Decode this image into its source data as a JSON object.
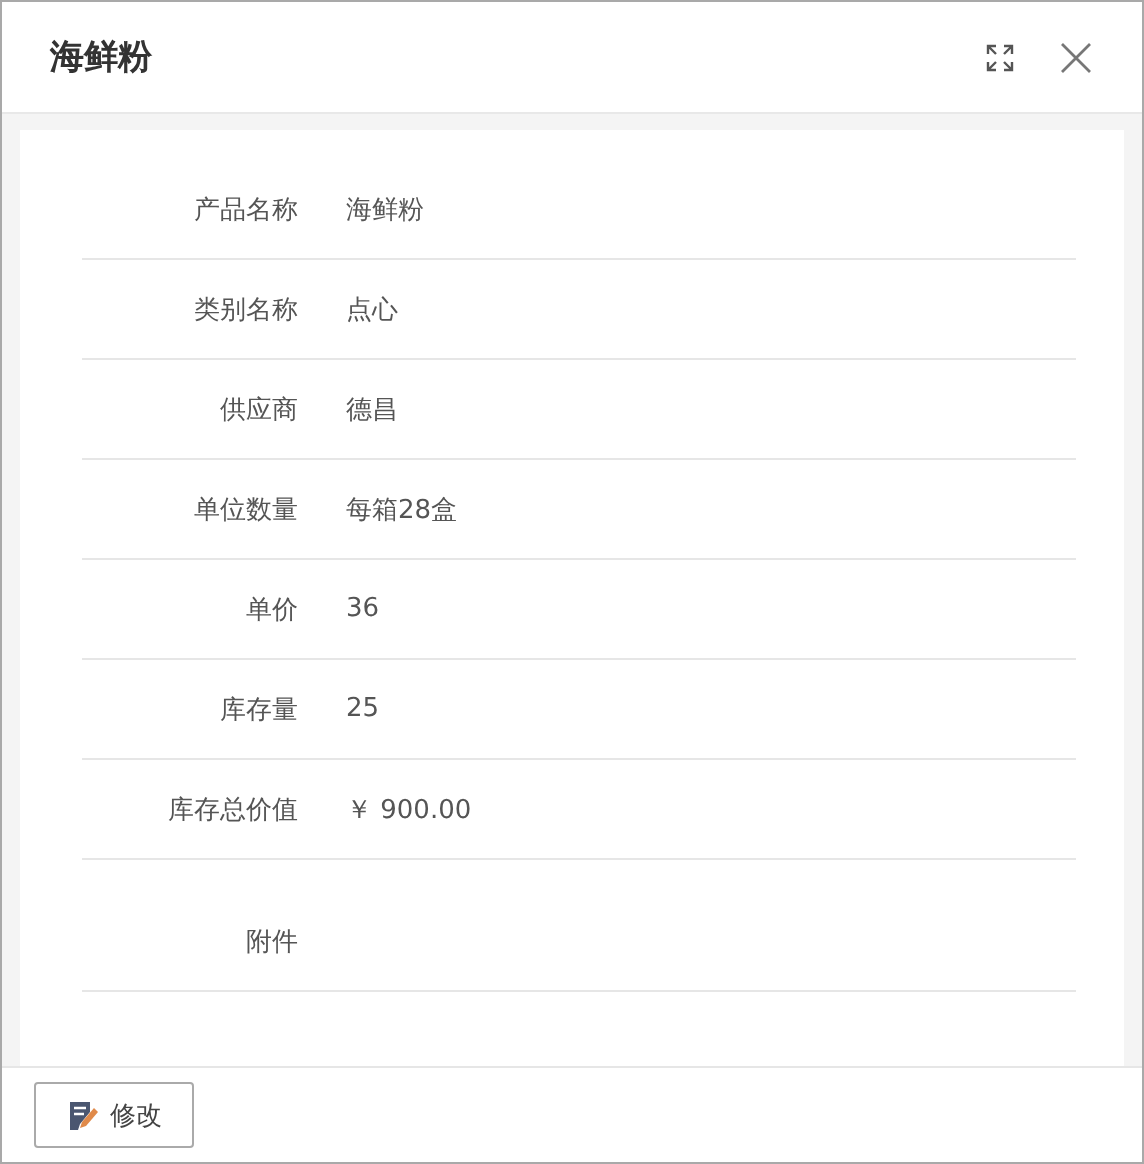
{
  "window": {
    "title": "海鲜粉"
  },
  "fields": [
    {
      "label": "产品名称",
      "value": "海鲜粉"
    },
    {
      "label": "类别名称",
      "value": "点心"
    },
    {
      "label": "供应商",
      "value": "德昌"
    },
    {
      "label": "单位数量",
      "value": "每箱28盒"
    },
    {
      "label": "单价",
      "value": "36"
    },
    {
      "label": "库存量",
      "value": "25"
    },
    {
      "label": "库存总价值",
      "value": "￥ 900.00"
    },
    {
      "label": "附件"
    }
  ],
  "buttons": [
    {
      "label": "修改"
    }
  ]
}
